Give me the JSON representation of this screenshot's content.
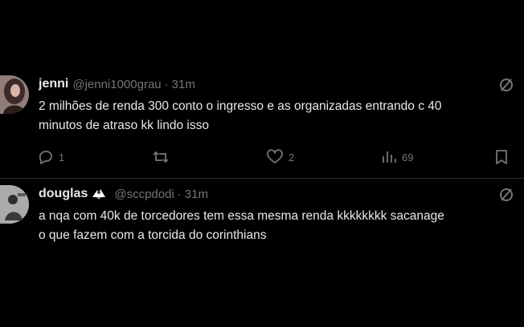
{
  "tweets": [
    {
      "name": "jenni",
      "handle": "@jenni1000grau",
      "separator": "·",
      "time": "31m",
      "text_lines": [
        "2 milhões de renda 300 conto o ingresso e as organizadas entrando c 40",
        "minutos de atraso kk lindo isso"
      ],
      "stats": {
        "replies": "1",
        "retweets": "",
        "likes": "2",
        "views": "69"
      },
      "icons": {
        "more": "slash-circle-icon",
        "reply": "reply-icon",
        "retweet": "retweet-icon",
        "like": "heart-icon",
        "views": "views-icon",
        "bookmark": "bookmark-icon"
      }
    },
    {
      "name": "douglas",
      "badge_icon": "eagle-emoji-icon",
      "handle": "@sccpdodi",
      "separator": "·",
      "time": "31m",
      "text_lines": [
        "a nqa com 40k de torcedores tem essa mesma renda kkkkkkkk sacanage",
        "o que fazem com a torcida do corinthians"
      ],
      "icons": {
        "more": "slash-circle-icon"
      }
    }
  ],
  "colors": {
    "background": "#000000",
    "text": "#e7e9ea",
    "secondary": "#71767b",
    "divider": "#2f3336"
  }
}
